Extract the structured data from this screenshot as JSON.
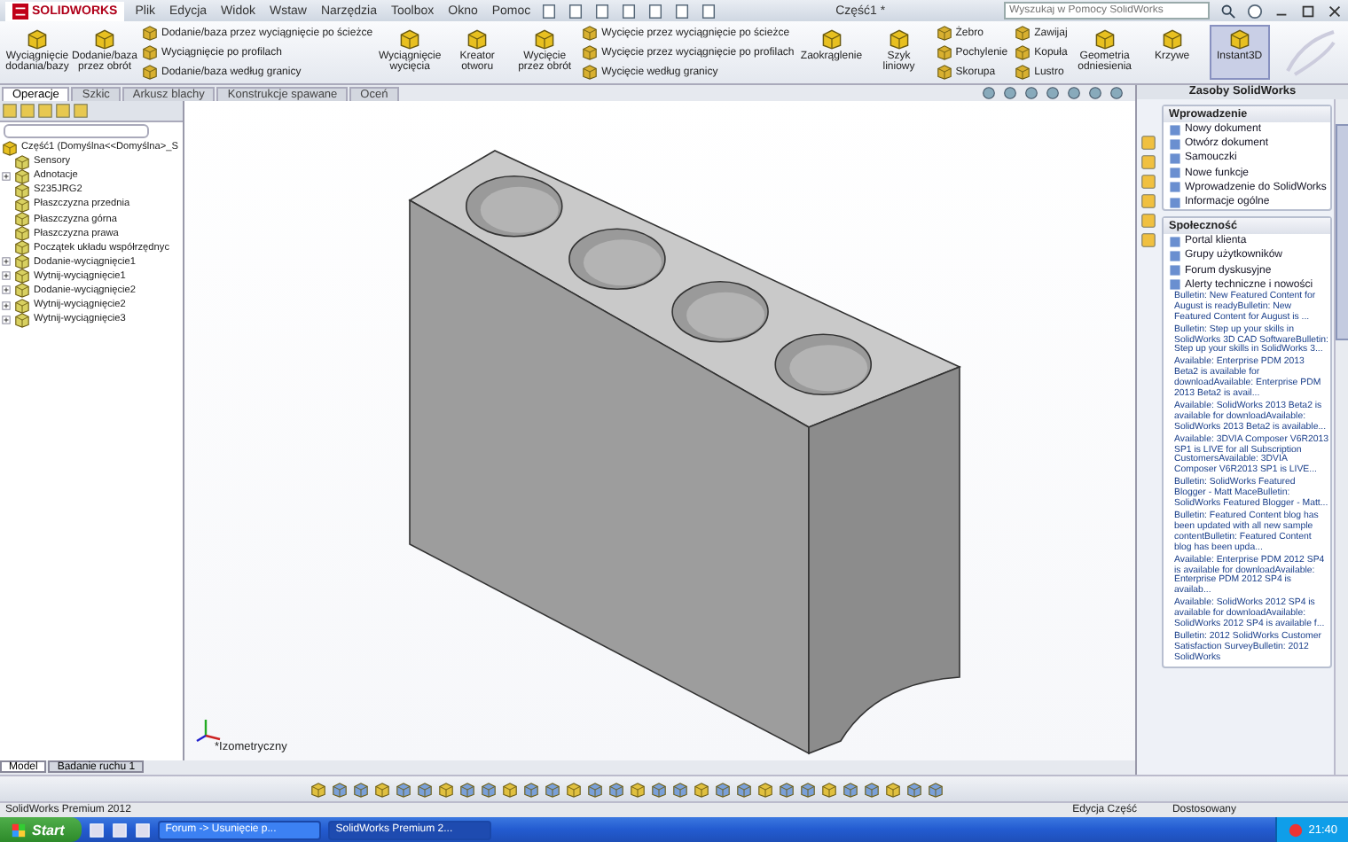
{
  "app": {
    "logo": "SOLIDWORKS",
    "menu": [
      "Plik",
      "Edycja",
      "Widok",
      "Wstaw",
      "Narzędzia",
      "Toolbox",
      "Okno",
      "Pomoc"
    ],
    "title": "Część1 *",
    "search": {
      "placeholder": "Wyszukaj w Pomocy SolidWorks"
    }
  },
  "ribbon": [
    {
      "kind": "large",
      "label": "Wyciągnięcie dodania/bazy",
      "selected": false
    },
    {
      "kind": "large",
      "label": "Dodanie/baza przez obrót",
      "selected": false
    },
    {
      "kind": "stack",
      "items": [
        "Dodanie/baza przez wyciągnięcie po ścieżce",
        "Wyciągnięcie po profilach",
        "Dodanie/baza według granicy"
      ]
    },
    {
      "kind": "large",
      "label": "Wyciągnięcie wycięcia",
      "selected": false
    },
    {
      "kind": "large",
      "label": "Kreator otworu",
      "selected": false
    },
    {
      "kind": "large",
      "label": "Wycięcie przez obrót",
      "selected": false
    },
    {
      "kind": "stack",
      "items": [
        "Wycięcie przez wyciągnięcie po ścieżce",
        "Wycięcie przez wyciągnięcie po profilach",
        "Wycięcie według granicy"
      ]
    },
    {
      "kind": "large",
      "label": "Zaokrąglenie",
      "selected": false
    },
    {
      "kind": "large",
      "label": "Szyk liniowy",
      "selected": false
    },
    {
      "kind": "stack",
      "items": [
        "Żebro",
        "Pochylenie",
        "Skorupa"
      ]
    },
    {
      "kind": "stack",
      "items": [
        "Zawijaj",
        "Kopuła",
        "Lustro"
      ]
    },
    {
      "kind": "large",
      "label": "Geometria odniesienia",
      "selected": false
    },
    {
      "kind": "large",
      "label": "Krzywe",
      "selected": false
    },
    {
      "kind": "large",
      "label": "Instant3D",
      "selected": true
    }
  ],
  "command_tabs": [
    {
      "label": "Operacje",
      "selected": true
    },
    {
      "label": "Szkic",
      "selected": false
    },
    {
      "label": "Arkusz blachy",
      "selected": false
    },
    {
      "label": "Konstrukcje spawane",
      "selected": false
    },
    {
      "label": "Oceń",
      "selected": false
    }
  ],
  "tree": {
    "root": "Część1  (Domyślna<<Domyślna>_S",
    "items": [
      {
        "label": "Sensory",
        "expandable": false
      },
      {
        "label": "Adnotacje",
        "expandable": true
      },
      {
        "label": "S235JRG2",
        "expandable": false
      },
      {
        "label": "Płaszczyzna przednia",
        "expandable": false
      },
      {
        "label": "Płaszczyzna górna",
        "expandable": false
      },
      {
        "label": "Płaszczyzna prawa",
        "expandable": false
      },
      {
        "label": "Początek układu współrzędnyc",
        "expandable": false
      },
      {
        "label": "Dodanie-wyciągnięcie1",
        "expandable": true
      },
      {
        "label": "Wytnij-wyciągnięcie1",
        "expandable": true
      },
      {
        "label": "Dodanie-wyciągnięcie2",
        "expandable": true
      },
      {
        "label": "Wytnij-wyciągnięcie2",
        "expandable": true
      },
      {
        "label": "Wytnij-wyciągnięcie3",
        "expandable": true
      }
    ]
  },
  "viewport": {
    "view_label": "*Izometryczny"
  },
  "model_tabs": [
    {
      "label": "Model",
      "selected": true
    },
    {
      "label": "Badanie ruchu 1",
      "selected": false
    }
  ],
  "task_pane": {
    "title": "Zasoby SolidWorks",
    "sections": [
      {
        "title": "Wprowadzenie",
        "links": [
          "Nowy dokument",
          "Otwórz dokument",
          "Samouczki",
          "Nowe funkcje",
          "Wprowadzenie do SolidWorks",
          "Informacje ogólne"
        ]
      },
      {
        "title": "Społeczność",
        "links": [
          "Portal klienta",
          "Grupy użytkowników",
          "Forum dyskusyjne",
          "Alerty techniczne i nowości"
        ]
      }
    ],
    "bulletins": [
      "Bulletin: New Featured Content for August is readyBulletin: New Featured Content for August is ...",
      "Bulletin: Step up your skills in SolidWorks 3D CAD SoftwareBulletin: Step up your skills in SolidWorks 3...",
      "Available: Enterprise PDM 2013 Beta2 is available for downloadAvailable: Enterprise PDM 2013 Beta2 is avail...",
      "Available: SolidWorks 2013 Beta2 is available for downloadAvailable: SolidWorks 2013 Beta2 is available...",
      "Available: 3DVIA Composer V6R2013 SP1 is LIVE for all Subscription CustomersAvailable: 3DVIA Composer V6R2013 SP1 is LIVE...",
      "Bulletin: SolidWorks Featured Blogger - Matt MaceBulletin: SolidWorks Featured Blogger - Matt...",
      "Bulletin: Featured Content blog has been updated with all new sample contentBulletin: Featured Content blog has been upda...",
      "Available: Enterprise PDM 2012 SP4 is available for downloadAvailable: Enterprise PDM 2012 SP4 is availab...",
      "Available: SolidWorks 2012 SP4 is available for downloadAvailable: SolidWorks 2012 SP4 is available f...",
      "Bulletin: 2012 SolidWorks Customer Satisfaction SurveyBulletin: 2012 SolidWorks"
    ]
  },
  "status_bar": {
    "product": "SolidWorks Premium 2012",
    "mode": "Edycja Część",
    "units": "Dostosowany"
  },
  "taskbar": {
    "start": "Start",
    "windows": [
      {
        "label": "Forum -> Usunięcie p...",
        "selected": false
      },
      {
        "label": "SolidWorks Premium 2...",
        "selected": true
      }
    ],
    "clock": "21:40"
  }
}
